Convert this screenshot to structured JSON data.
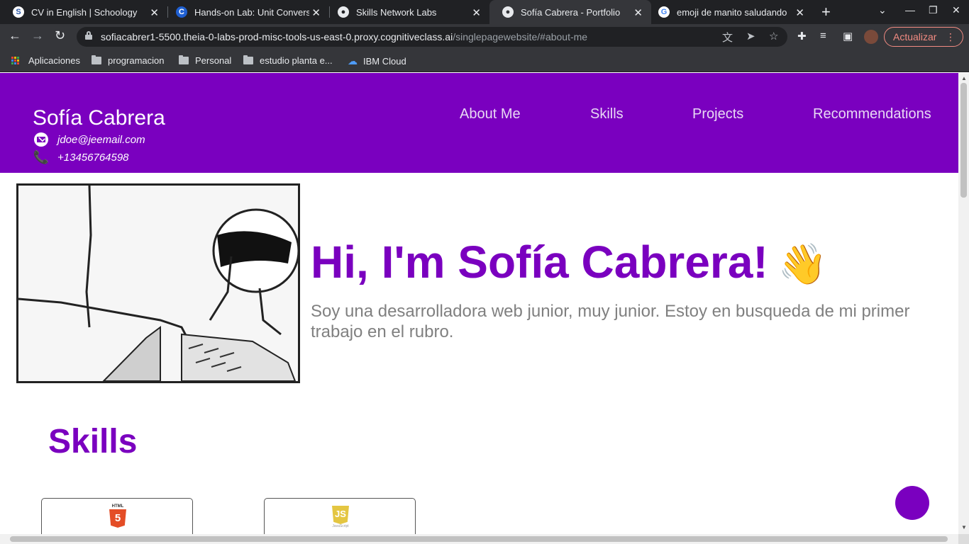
{
  "browser": {
    "tabs": [
      {
        "title": "CV in English | Schoology",
        "icon": "schoology-icon",
        "active": false
      },
      {
        "title": "Hands-on Lab: Unit Convers",
        "icon": "coursera-icon",
        "active": false
      },
      {
        "title": "Skills Network Labs",
        "icon": "globe-icon",
        "active": false
      },
      {
        "title": "Sofía Cabrera - Portfolio",
        "icon": "globe-icon",
        "active": true
      },
      {
        "title": "emoji de manito saludando",
        "icon": "google-icon",
        "active": false
      }
    ],
    "url_host": "sofiacabrer1-5500.theia-0-labs-prod-misc-tools-us-east-0.proxy.cognitiveclass.ai",
    "url_path": "/singlepagewebsite/#about-me",
    "update_label": "Actualizar",
    "bookmarks": [
      {
        "label": "Aplicaciones",
        "icon": "apps-grid-icon"
      },
      {
        "label": "programacion",
        "icon": "folder-icon"
      },
      {
        "label": "Personal",
        "icon": "folder-icon"
      },
      {
        "label": "estudio planta e...",
        "icon": "folder-icon"
      },
      {
        "label": "IBM Cloud",
        "icon": "cloud-icon"
      }
    ]
  },
  "page": {
    "header": {
      "name": "Sofía Cabrera",
      "email": "jdoe@jeemail.com",
      "phone": "+13456764598",
      "nav": [
        "About Me",
        "Skills",
        "Projects",
        "Recommendations"
      ]
    },
    "hero": {
      "title": "Hi, I'm Sofía Cabrera!",
      "description": "Soy una desarrolladora web junior, muy junior. Estoy en busqueda de mi primer trabajo en el rubro."
    },
    "skills": {
      "heading": "Skills",
      "cards": [
        {
          "logo_text": "HTML",
          "icon": "html5-icon"
        },
        {
          "logo_text": "JavaScript",
          "icon": "javascript-icon"
        }
      ]
    },
    "accent_color": "#7a00bf"
  }
}
